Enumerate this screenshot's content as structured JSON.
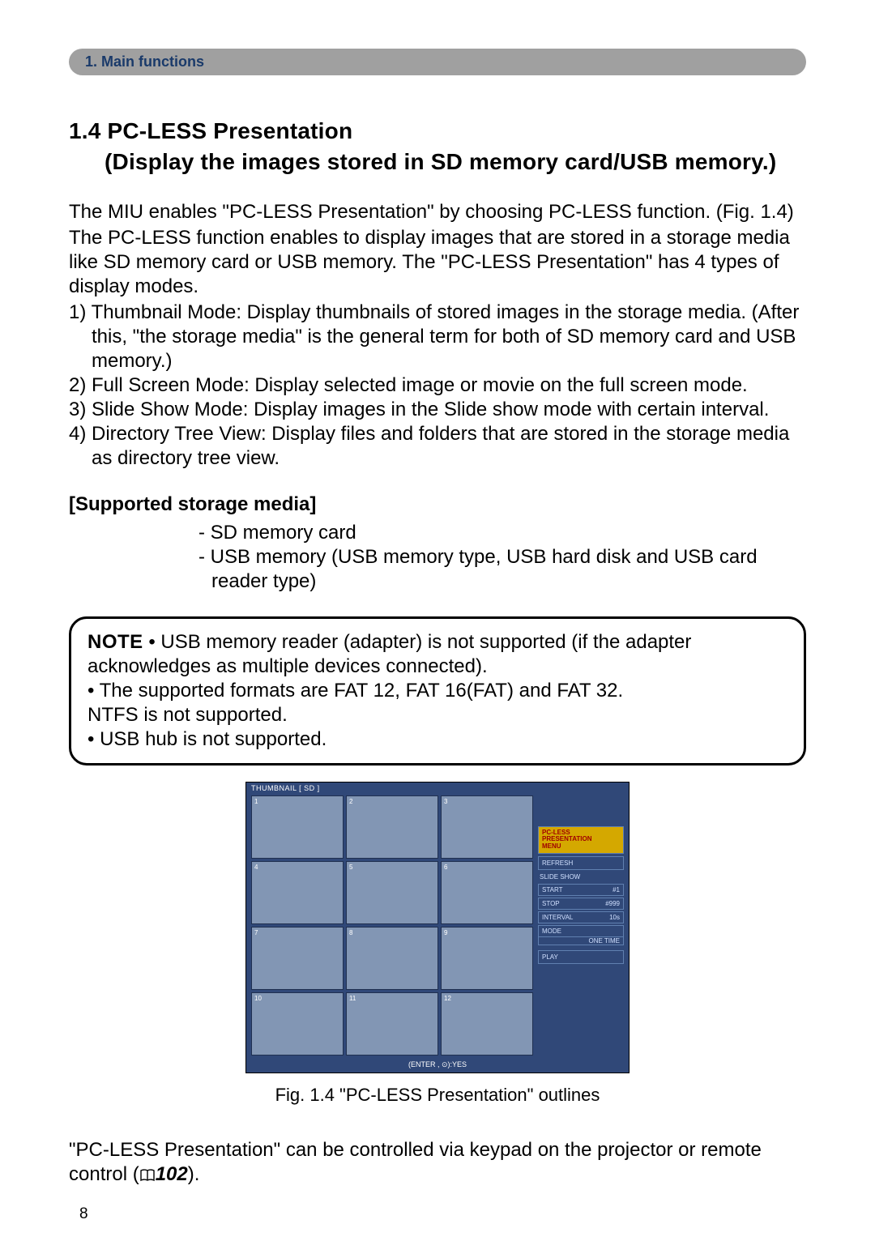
{
  "header": {
    "breadcrumb": "1. Main functions"
  },
  "section": {
    "number": "1.4",
    "title_line1": "PC-LESS Presentation",
    "title_line2": "(Display the images stored in SD memory card/USB memory.)"
  },
  "intro": {
    "p1": "The MIU enables \"PC-LESS Presentation\" by choosing PC-LESS function. (Fig. 1.4)",
    "p2": "The PC-LESS function enables to display images that are stored in a storage media like SD memory card or USB memory. The \"PC-LESS Presentation\" has 4 types of display modes."
  },
  "modes": {
    "m1": "1) Thumbnail Mode: Display thumbnails of stored images in the storage media. (After this, \"the storage media\" is the general term for both of SD memory card and USB memory.)",
    "m2": "2) Full Screen Mode: Display selected image or movie on the full screen mode.",
    "m3": "3) Slide Show Mode: Display images in the Slide show mode with certain interval.",
    "m4": "4) Directory Tree View: Display files and folders that are stored in the storage media as directory tree view."
  },
  "supported": {
    "heading": "[Supported storage media]",
    "b1": "- SD memory card",
    "b2": "- USB memory (USB memory type, USB hard disk and USB card reader type)"
  },
  "note": {
    "label": "NOTE",
    "n1_prefix": "• USB memory reader (adapter) is not supported (if the adapter acknowledges as multiple devices connected).",
    "n2": "• The supported formats are FAT 12, FAT 16(FAT) and FAT 32.",
    "n3": "NTFS is not supported.",
    "n4": "• USB hub is not supported."
  },
  "figure": {
    "title": "THUMBNAIL   [ SD ]",
    "cells": [
      "1",
      "2",
      "3",
      "4",
      "5",
      "6",
      "7",
      "8",
      "9",
      "10",
      "11",
      "12"
    ],
    "menu": {
      "header": "PC-LESS\nPRESENTATION\nMENU",
      "refresh": "REFRESH",
      "slideshow_label": "SLIDE SHOW",
      "start_label": "START",
      "start_val": "#1",
      "stop_label": "STOP",
      "stop_val": "#999",
      "interval_label": "INTERVAL",
      "interval_val": "10s",
      "mode_label": "MODE",
      "mode_val": "ONE TIME",
      "play": "PLAY"
    },
    "footer": "(ENTER , ⊙):YES",
    "caption": "Fig. 1.4 \"PC-LESS Presentation\" outlines"
  },
  "closing": {
    "text_before": "\"PC-LESS Presentation\" can be controlled via keypad on the projector or remote control (",
    "ref": "102",
    "text_after": ")."
  },
  "page_number": "8"
}
